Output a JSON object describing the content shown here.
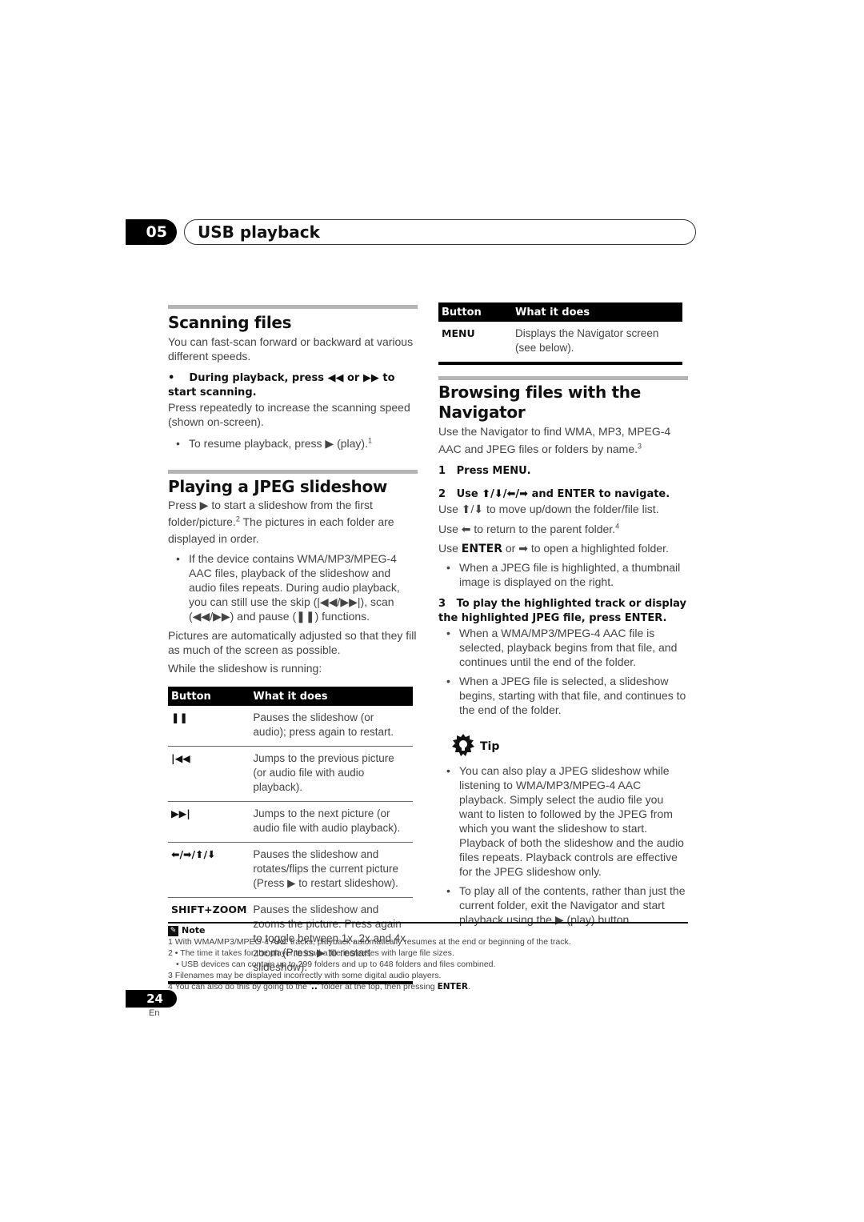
{
  "header": {
    "chapter_number": "05",
    "chapter_title": "USB playback"
  },
  "scanning": {
    "title": "Scanning files",
    "intro": "You can fast-scan forward or backward at various different speeds.",
    "step_bullet": "•",
    "step_text": "During playback, press ◀◀ or ▶▶ to start scanning.",
    "step_detail": "Press repeatedly to increase the scanning speed (shown on-screen).",
    "bullet_resume": "To resume playback, press ▶ (play).",
    "bullet_resume_ref": "1"
  },
  "slideshow": {
    "title": "Playing a JPEG slideshow",
    "intro_a": "Press ▶ to start a slideshow from the first folder/picture.",
    "intro_ref": "2",
    "intro_b": " The pictures in each folder are displayed in order.",
    "bullet_audio": "If the device contains WMA/MP3/MPEG-4 AAC files, playback of the slideshow and audio files repeats. During audio playback, you can still use the skip (|◀◀/▶▶|), scan (◀◀/▶▶) and pause (❚❚) functions.",
    "para_adjust": "Pictures are automatically adjusted so that they fill as much of the screen as possible.",
    "para_running": "While the slideshow is running:",
    "table": {
      "headers": [
        "Button",
        "What it does"
      ],
      "rows": [
        {
          "key": "❚❚",
          "key_icon": "pause-icon",
          "desc": "Pauses the slideshow (or audio); press again to restart."
        },
        {
          "key": "|◀◀",
          "key_icon": "skip-previous-icon",
          "desc": "Jumps to the previous picture (or audio file with audio playback)."
        },
        {
          "key": "▶▶|",
          "key_icon": "skip-next-icon",
          "desc": "Jumps to the next picture (or audio file with audio playback)."
        },
        {
          "key": "⬅/➡/⬆/⬇",
          "key_icon": "arrow-keys-icon",
          "desc": "Pauses the slideshow and rotates/flips the current picture (Press ▶ to restart slideshow)."
        },
        {
          "key": "SHIFT+ZOOM",
          "key_icon": "",
          "desc": "Pauses the slideshow and zooms the picture. Press again to toggle between 1x, 2x and 4x zoom (Press ▶ to restart slideshow)."
        }
      ]
    }
  },
  "menu_table": {
    "headers": [
      "Button",
      "What it does"
    ],
    "rows": [
      {
        "key": "MENU",
        "desc": "Displays the Navigator screen (see below)."
      }
    ]
  },
  "navigator": {
    "title": "Browsing files with the Navigator",
    "intro": "Use the Navigator to find WMA, MP3, MPEG-4 AAC and JPEG files or folders by name.",
    "intro_ref": "3",
    "step1_num": "1",
    "step1": "Press MENU.",
    "step2_num": "2",
    "step2": "Use ⬆/⬇/⬅/➡ and ENTER to navigate.",
    "step2_line1": "Use ⬆/⬇ to move up/down the folder/file list.",
    "step2_line2": "Use ⬅ to return to the parent folder.",
    "step2_line2_ref": "4",
    "step2_line3_a": "Use ",
    "step2_line3_enter": "ENTER",
    "step2_line3_b": " or ➡ to open a highlighted folder.",
    "step2_bullet": "When a JPEG file is highlighted, a thumbnail image is displayed on the right.",
    "step3_num": "3",
    "step3": "To play the highlighted track or display the highlighted JPEG file, press ENTER.",
    "step3_bullets": [
      "When a WMA/MP3/MPEG-4 AAC file is selected, playback begins from that file, and continues until the end of the folder.",
      "When a JPEG file is selected, a slideshow begins, starting with that file, and continues to the end of the folder."
    ]
  },
  "tip": {
    "label": "Tip",
    "bullets": [
      "You can also play a JPEG slideshow while listening to WMA/MP3/MPEG-4 AAC playback. Simply select the audio file you want to listen to followed by the JPEG from which you want the slideshow to start. Playback of both the slideshow and the audio files repeats. Playback controls are effective for the JPEG slideshow only.",
      "To play all of the contents, rather than just the current folder, exit the Navigator and start playback using the ▶ (play) button."
    ]
  },
  "notes": {
    "label": "Note",
    "items": [
      "1 With WMA/MP3/MPEG-4 AAC tracks, playback automatically resumes at the end or beginning of the track.",
      "2 • The time it takes for the player to load a file increases with large file sizes.",
      "   • USB devices can contain up to 299 folders and up to 648 folders and files combined.",
      "3 Filenames may be displayed incorrectly with some digital audio players."
    ],
    "item4_a": "4 You can also do this by going to the '",
    "item4_dots": "..",
    "item4_b": "' folder at the top, then pressing ",
    "item4_enter": "ENTER",
    "item4_c": "."
  },
  "footer": {
    "page_number": "24",
    "language": "En"
  }
}
